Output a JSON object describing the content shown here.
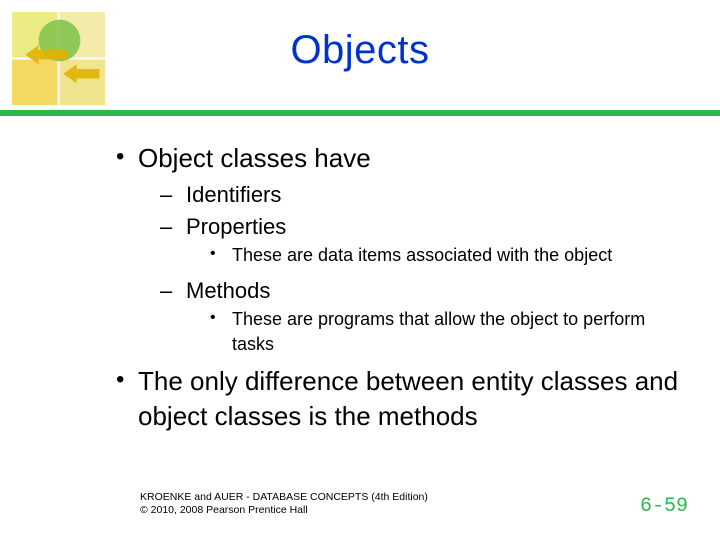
{
  "title": "Objects",
  "bullets": {
    "b0": "Object classes have",
    "b0_0": "Identifiers",
    "b0_1": "Properties",
    "b0_1_0": "These are data items associated with the object",
    "b0_2": "Methods",
    "b0_2_0": "These are programs that allow the object to perform tasks",
    "b1": "The only difference between entity classes and object classes is the methods"
  },
  "footer": {
    "line1": "KROENKE and AUER - DATABASE CONCEPTS (4th Edition)",
    "line2": "© 2010, 2008 Pearson Prentice Hall"
  },
  "page": "6-59"
}
